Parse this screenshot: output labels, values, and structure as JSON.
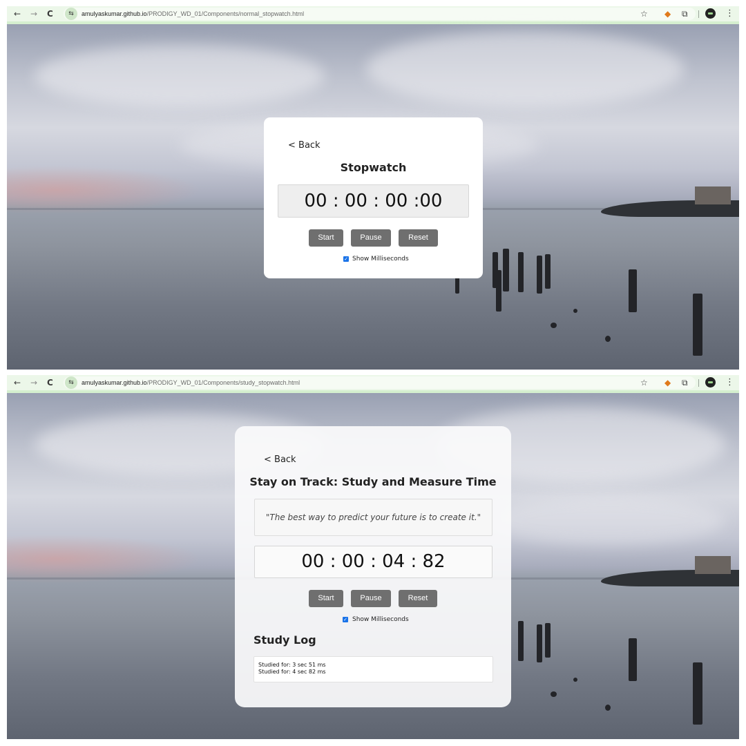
{
  "browser": {
    "back_glyph": "←",
    "forward_glyph": "→",
    "reload_glyph": "C",
    "site_info_glyph": "⇆",
    "star_glyph": "☆",
    "extension_glyph": "⧉",
    "menu_glyph": "⋮"
  },
  "screen1": {
    "url_host": "amulyaskumar.github.io",
    "url_path": "/PRODIGY_WD_01/Components/normal_stopwatch.html",
    "back_label": "< Back",
    "title": "Stopwatch",
    "time_display": "00 : 00 : 00 :00",
    "buttons": {
      "start": "Start",
      "pause": "Pause",
      "reset": "Reset"
    },
    "show_ms_label": "Show Milliseconds",
    "show_ms_checked": true
  },
  "screen2": {
    "url_host": "amulyaskumar.github.io",
    "url_path": "/PRODIGY_WD_01/Components/study_stopwatch.html",
    "back_label": "< Back",
    "title": "Stay on Track: Study and Measure Time",
    "quote": "\"The best way to predict your future is to create it.\"",
    "time_display": "00 : 00 : 04 : 82",
    "buttons": {
      "start": "Start",
      "pause": "Pause",
      "reset": "Reset"
    },
    "show_ms_label": "Show Milliseconds",
    "show_ms_checked": true,
    "log_title": "Study Log",
    "log_entries": [
      "Studied for: 3 sec 51 ms",
      "Studied for: 4 sec 82 ms"
    ]
  },
  "colors": {
    "toolbar_bg": "#ecf7e9",
    "button_bg": "#6f6f6f",
    "checkbox": "#1a73e8"
  }
}
